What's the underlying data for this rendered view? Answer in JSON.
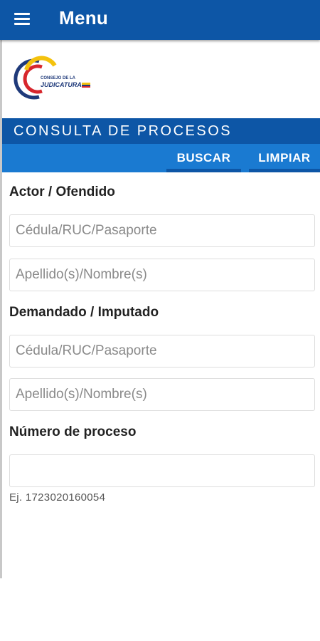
{
  "appbar": {
    "title": "Menu"
  },
  "logo": {
    "line1": "CONSEJO DE LA",
    "line2": "JUDICATURA"
  },
  "section": {
    "title": "CONSULTA DE PROCESOS"
  },
  "toolbar": {
    "buscar": "BUSCAR",
    "limpiar": "LIMPIAR"
  },
  "actor": {
    "label": "Actor / Ofendido",
    "id_placeholder": "Cédula/RUC/Pasaporte",
    "name_placeholder": "Apellido(s)/Nombre(s)"
  },
  "demandado": {
    "label": "Demandado / Imputado",
    "id_placeholder": "Cédula/RUC/Pasaporte",
    "name_placeholder": "Apellido(s)/Nombre(s)"
  },
  "proceso": {
    "label": "Número de proceso",
    "value": "",
    "hint": "Ej. 1723020160054"
  },
  "colors": {
    "primary": "#0d56a6",
    "accent": "#1a7ad1"
  }
}
